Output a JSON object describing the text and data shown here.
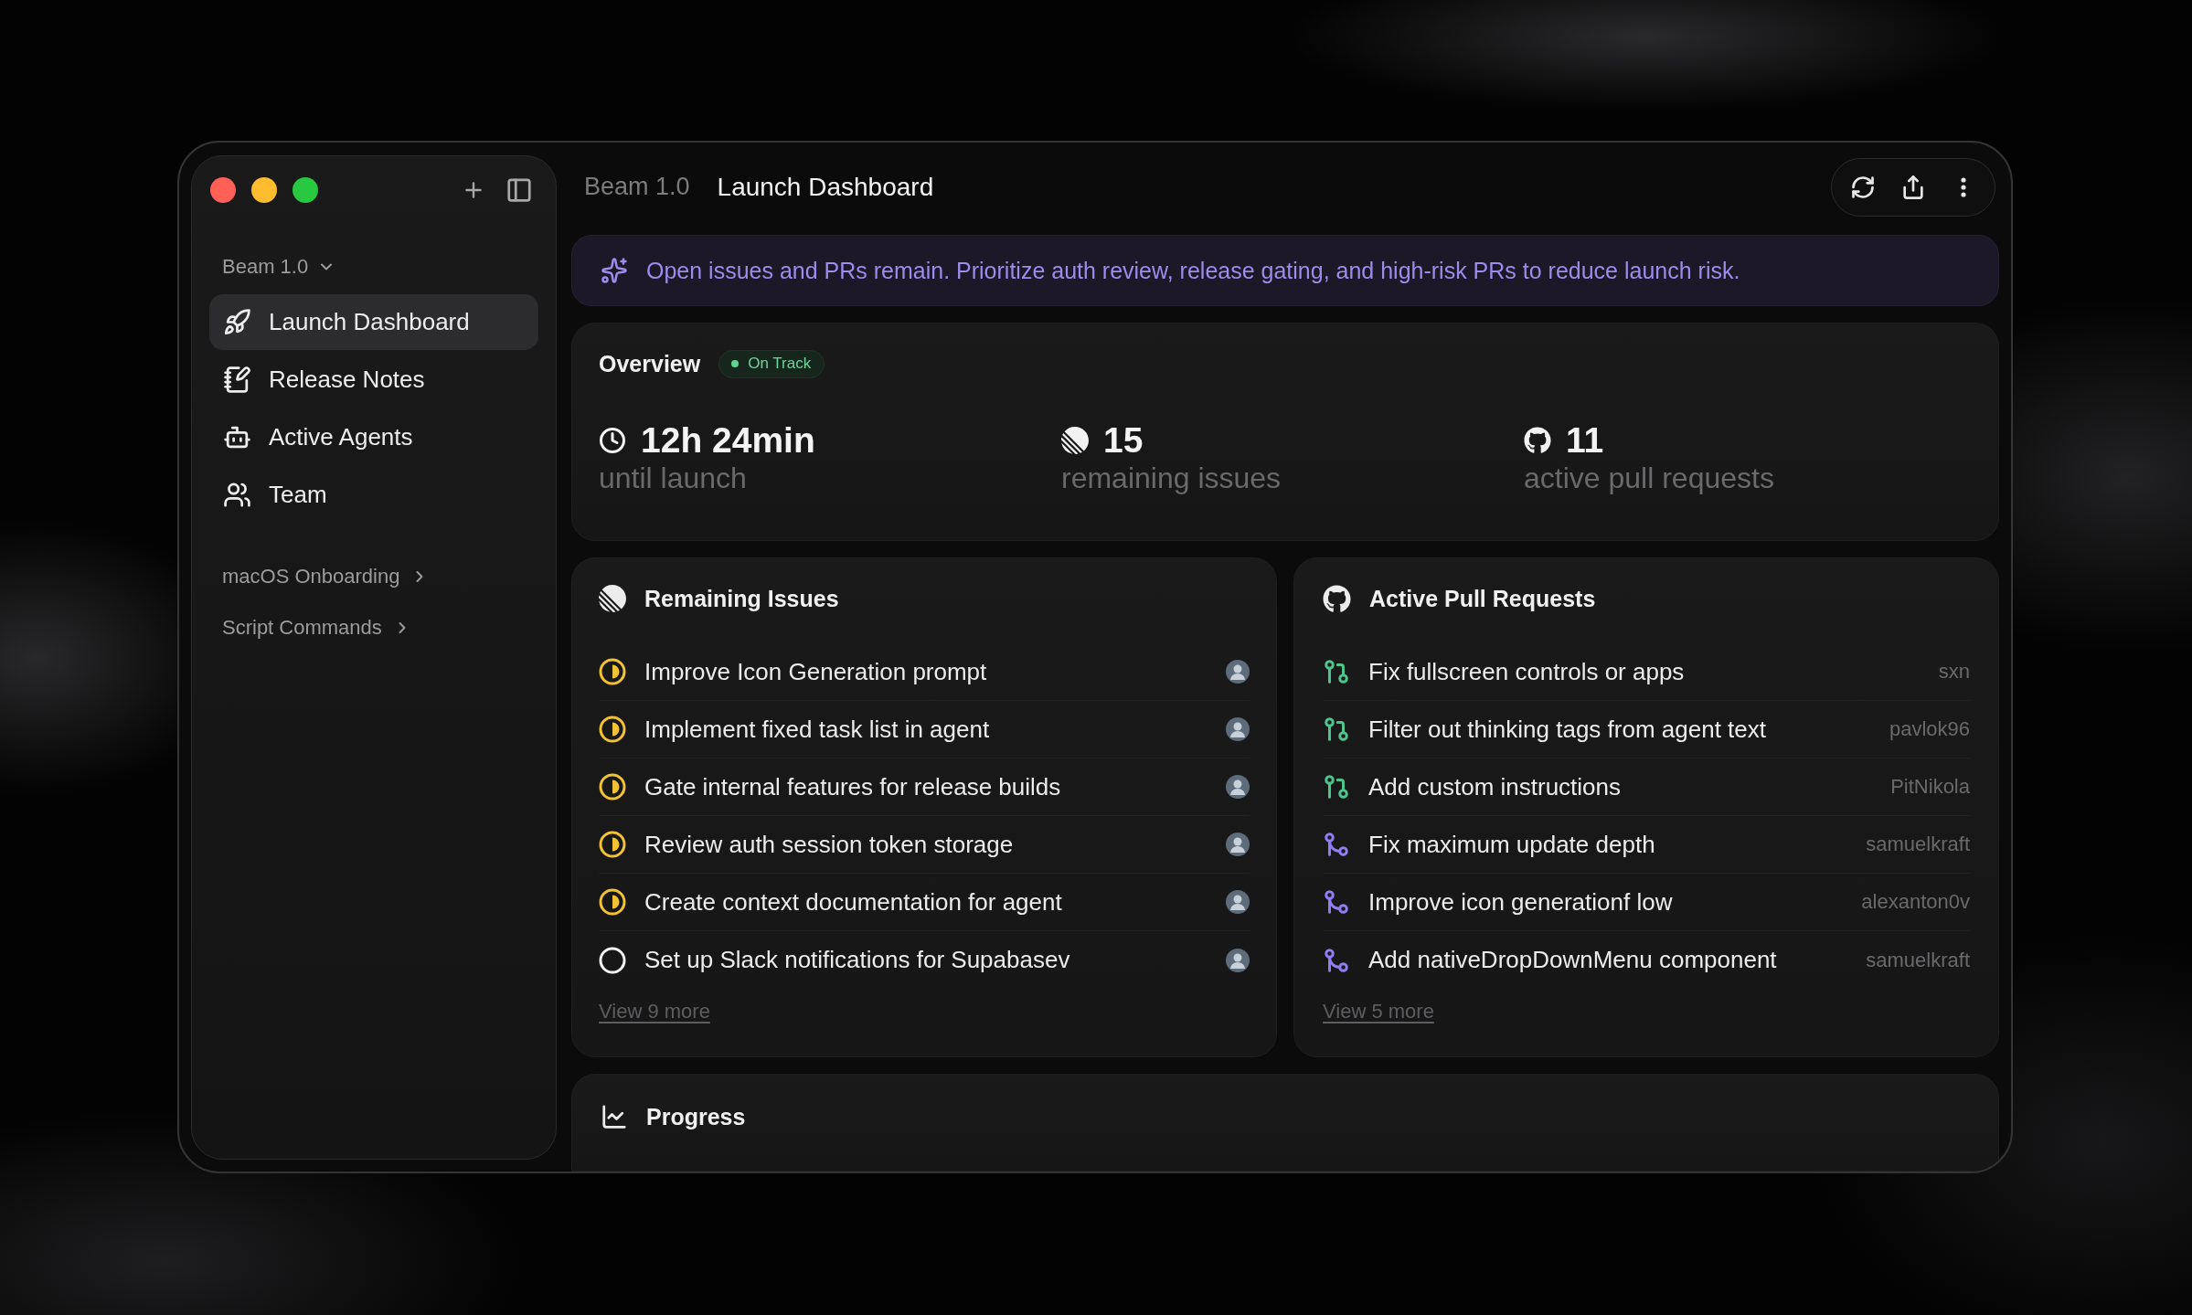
{
  "sidebar": {
    "project": "Beam 1.0",
    "items": [
      {
        "label": "Launch Dashboard",
        "selected": true
      },
      {
        "label": "Release Notes",
        "selected": false
      },
      {
        "label": "Active Agents",
        "selected": false
      },
      {
        "label": "Team",
        "selected": false
      }
    ],
    "sections": [
      "macOS Onboarding",
      "Script Commands"
    ]
  },
  "header": {
    "breadcrumb": "Beam 1.0",
    "title": "Launch Dashboard"
  },
  "banner": {
    "text": "Open issues and PRs remain. Prioritize auth review, release gating, and high-risk PRs to reduce launch risk."
  },
  "overview": {
    "title": "Overview",
    "status": "On Track",
    "stats": [
      {
        "value": "12h 24min",
        "label": "until launch"
      },
      {
        "value": "15",
        "label": "remaining issues"
      },
      {
        "value": "11",
        "label": "active pull requests"
      }
    ]
  },
  "issues": {
    "title": "Remaining Issues",
    "items": [
      {
        "title": "Improve Icon Generation prompt",
        "kind": "started"
      },
      {
        "title": "Implement fixed task list in agent",
        "kind": "started"
      },
      {
        "title": "Gate internal features for release builds",
        "kind": "started"
      },
      {
        "title": "Review auth session token storage",
        "kind": "started"
      },
      {
        "title": "Create context documentation for agent",
        "kind": "started"
      },
      {
        "title": "Set up Slack notifications for Supabasev",
        "kind": "todo"
      }
    ],
    "more": "View 9 more"
  },
  "pull_requests": {
    "title": "Active Pull Requests",
    "items": [
      {
        "title": "Fix fullscreen controls or apps",
        "author": "sxn",
        "kind": "open"
      },
      {
        "title": "Filter out thinking tags from agent text",
        "author": "pavlok96",
        "kind": "open"
      },
      {
        "title": "Add custom instructions",
        "author": "PitNikola",
        "kind": "open"
      },
      {
        "title": "Fix maximum update depth",
        "author": "samuelkraft",
        "kind": "merged"
      },
      {
        "title": "Improve icon generationf low",
        "author": "alexanton0v",
        "kind": "merged"
      },
      {
        "title": "Add nativeDropDownMenu component",
        "author": "samuelkraft",
        "kind": "merged"
      }
    ],
    "more": "View 5 more"
  },
  "progress": {
    "title": "Progress"
  }
}
